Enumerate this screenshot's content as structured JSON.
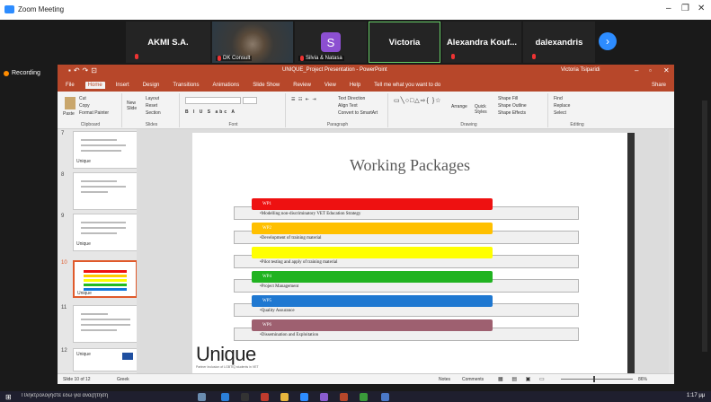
{
  "zoom": {
    "title": "Zoom Meeting",
    "min": "–",
    "max": "❐",
    "close": "✕"
  },
  "participants": [
    {
      "name": "AKMI S.A.",
      "type": "text"
    },
    {
      "name": "DK Consult",
      "type": "video"
    },
    {
      "name": "Silvia & Natasa",
      "type": "avatar",
      "initial": "S"
    },
    {
      "name": "Victoria",
      "type": "text",
      "active": true
    },
    {
      "name": "Alexandra Kouf...",
      "type": "text"
    },
    {
      "name": "dalexandris",
      "type": "text"
    }
  ],
  "recording": "Recording",
  "ppt": {
    "doc_title": "UNIQUE_Project Presentation - PowerPoint",
    "user": "Victoria Tsiparidi",
    "tabs": [
      "File",
      "Home",
      "Insert",
      "Design",
      "Transitions",
      "Animations",
      "Slide Show",
      "Review",
      "View",
      "Help",
      "Tell me what you want to do"
    ],
    "selected_tab": "Home",
    "share": "Share",
    "ribbon": {
      "clipboard": {
        "paste": "Paste",
        "cut": "Cut",
        "copy": "Copy",
        "format_painter": "Format Painter",
        "label": "Clipboard"
      },
      "slides": {
        "new_slide": "New Slide",
        "layout": "Layout",
        "reset": "Reset",
        "section": "Section",
        "label": "Slides"
      },
      "font_label": "Font",
      "paragraph": {
        "text_direction": "Text Direction",
        "align_text": "Align Text",
        "convert": "Convert to SmartArt",
        "label": "Paragraph"
      },
      "drawing": {
        "arrange": "Arrange",
        "quick_styles": "Quick Styles",
        "fill": "Shape Fill",
        "outline": "Shape Outline",
        "effects": "Shape Effects",
        "label": "Drawing"
      },
      "editing": {
        "find": "Find",
        "replace": "Replace",
        "select": "Select",
        "label": "Editing"
      }
    },
    "thumbnails": [
      {
        "num": "7",
        "label": "Unique"
      },
      {
        "num": "8",
        "label": ""
      },
      {
        "num": "9",
        "label": "Unique"
      },
      {
        "num": "10",
        "label": "Unique",
        "selected": true
      },
      {
        "num": "11",
        "label": ""
      },
      {
        "num": "12",
        "label": "Unique"
      }
    ],
    "slide": {
      "title": "Working Packages",
      "packages": [
        {
          "tag": "WP1",
          "text": "•Modelling non-discriminatory VET Education Strategy",
          "color": "#ee1111"
        },
        {
          "tag": "WP2",
          "text": "•Development of training material",
          "color": "#ffc000"
        },
        {
          "tag": "",
          "text": "•Pilot testing and apply of training material",
          "color": "#ffff00"
        },
        {
          "tag": "WP4",
          "text": "•Project Management",
          "color": "#21b321"
        },
        {
          "tag": "WP5",
          "text": "•Quality Assurance",
          "color": "#1f78d1"
        },
        {
          "tag": "WP6",
          "text": "•Dissemination and Exploitation",
          "color": "#9e6070"
        }
      ],
      "logo": "Unique",
      "logo_sub": "Partner Inclusion of LGBTIQ students in VET"
    },
    "status": {
      "slide_info": "Slide 10 of 12",
      "language": "Greek",
      "notes": "Notes",
      "comments": "Comments",
      "zoom": "86%"
    }
  },
  "taskbar": {
    "search": "Πληκτρολογήστε εδώ για αναζήτηση",
    "time": "1:17 μμ"
  }
}
